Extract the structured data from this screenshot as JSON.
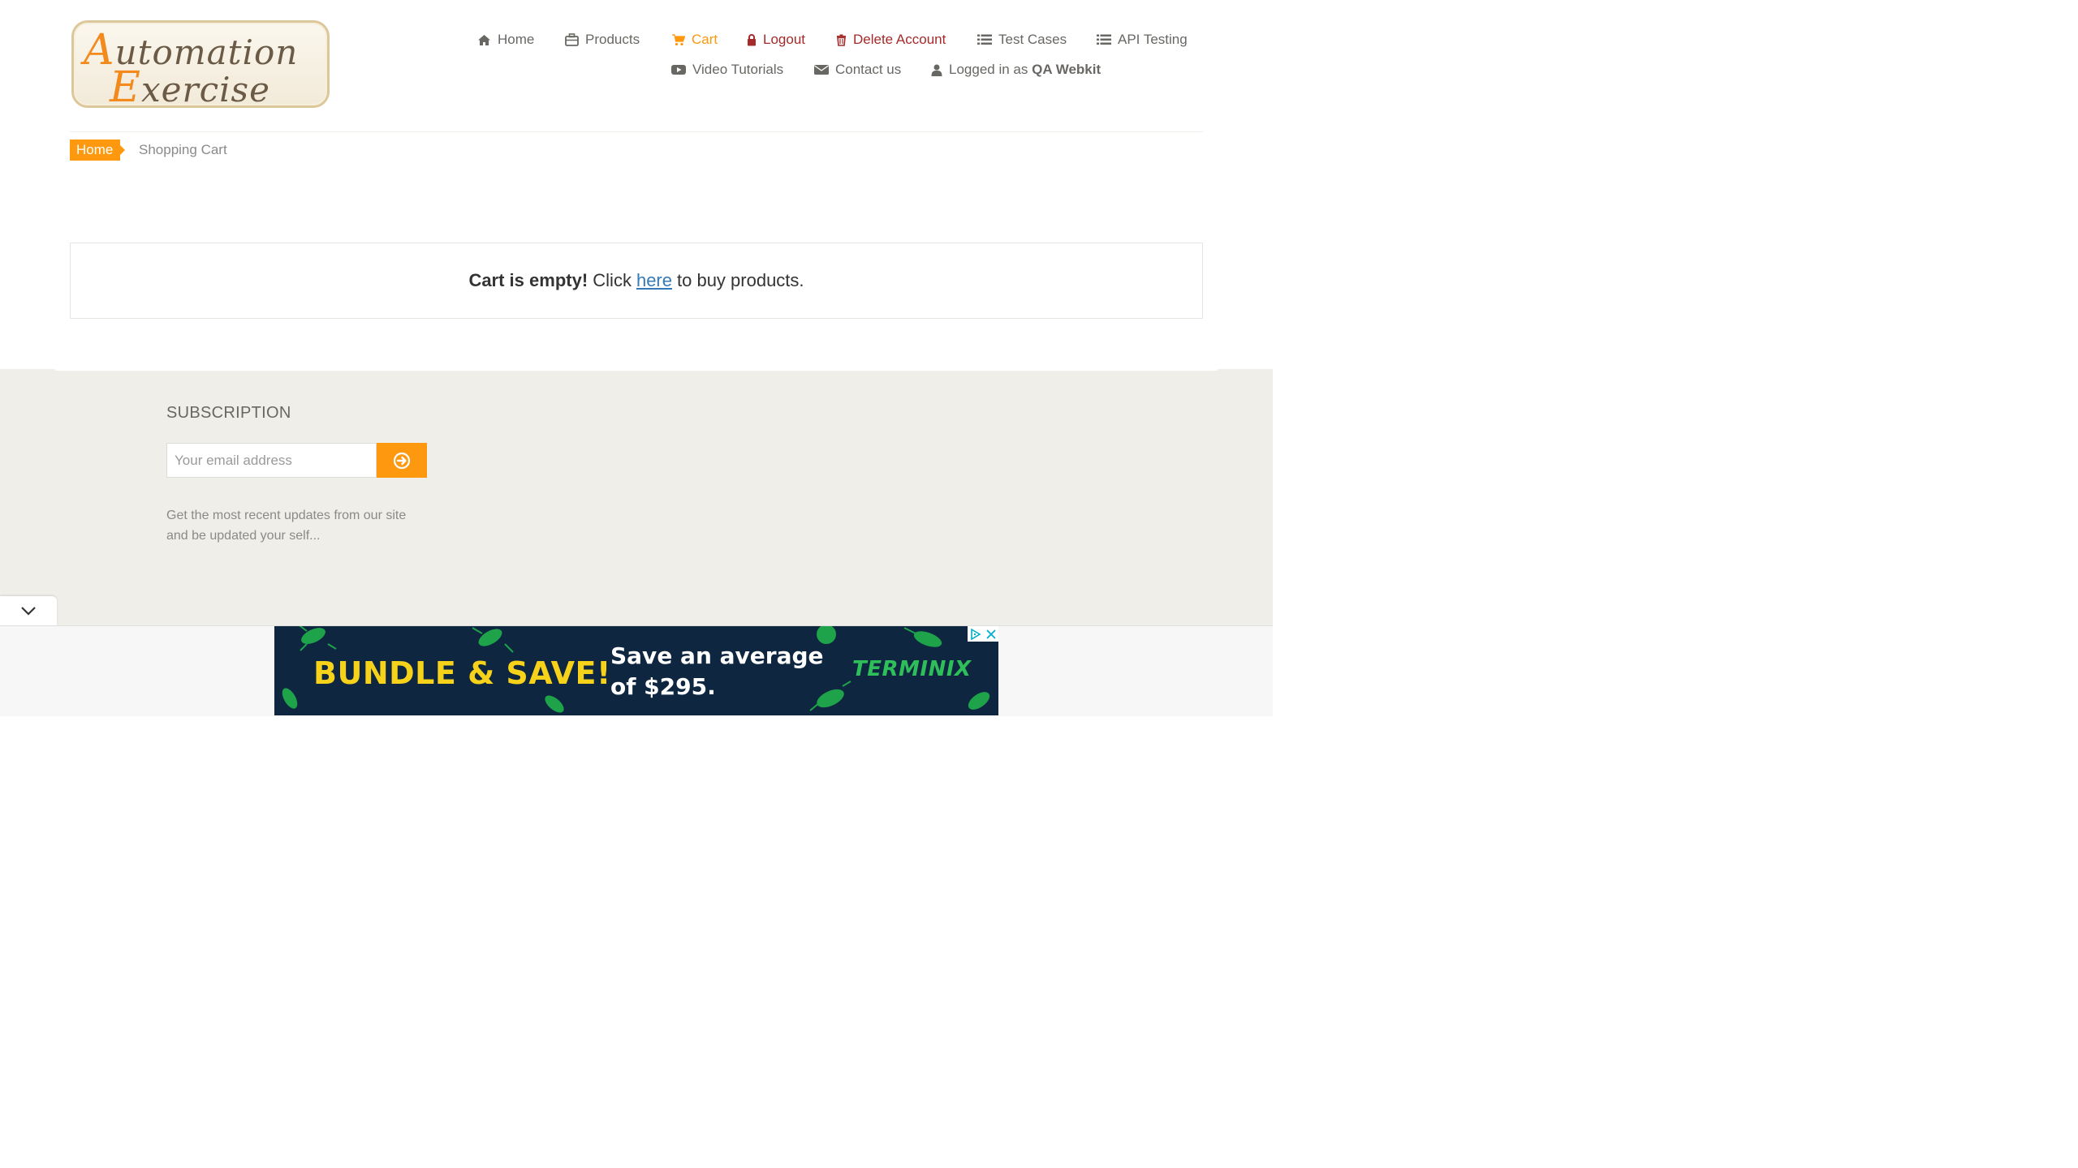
{
  "logo": {
    "line1_cap": "A",
    "line1_rest": "utomation",
    "line2_cap": "E",
    "line2_rest": "xercise"
  },
  "nav": {
    "items": [
      {
        "label": "Home",
        "icon": "home-icon"
      },
      {
        "label": "Products",
        "icon": "briefcase-icon"
      },
      {
        "label": "Cart",
        "icon": "shopping-cart-icon",
        "state": "active"
      },
      {
        "label": "Logout",
        "icon": "lock-icon"
      },
      {
        "label": "Delete Account",
        "icon": "trash-icon"
      },
      {
        "label": "Test Cases",
        "icon": "list-icon"
      },
      {
        "label": "API Testing",
        "icon": "list-icon"
      },
      {
        "label": "Video Tutorials",
        "icon": "youtube-play-icon"
      },
      {
        "label": "Contact us",
        "icon": "envelope-icon"
      }
    ],
    "logged_in_prefix": "Logged in as",
    "logged_in_user": "QA Webkit",
    "user_icon": "user-icon"
  },
  "breadcrumb": {
    "home": "Home",
    "current": "Shopping Cart"
  },
  "cart": {
    "empty_bold": "Cart is empty!",
    "click": "Click",
    "link": "here",
    "rest": "to buy products."
  },
  "subscription": {
    "title": "SUBSCRIPTION",
    "placeholder": "Your email address",
    "button_icon": "arrow-circle-right-icon",
    "text": "Get the most recent updates from our site and be updated your self..."
  },
  "ad": {
    "headline": "BUNDLE & SAVE!",
    "save_line1": "Save an average",
    "save_line2": "of $295.",
    "brand": "TERMINIX"
  },
  "colors": {
    "accent": "#fe980f",
    "danger": "#a52a2a",
    "link": "#337ab7",
    "footer_bg": "#efeee8",
    "ad_bg": "#0e2640",
    "ad_yellow": "#f7d21a",
    "ad_green": "#2fbf5a"
  }
}
